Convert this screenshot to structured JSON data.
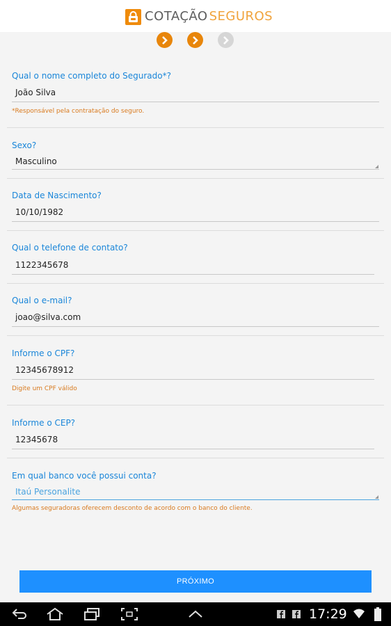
{
  "header": {
    "title_part1": "COTAÇÃO",
    "title_part2": "SEGUROS"
  },
  "steps": [
    {
      "state": "done",
      "icon": "chevron-right-icon"
    },
    {
      "state": "done",
      "icon": "chevron-right-icon"
    },
    {
      "state": "pending",
      "icon": "chevron-right-icon"
    }
  ],
  "form": {
    "name": {
      "label": "Qual o nome completo do Segurado*?",
      "value": "João Silva",
      "hint": "*Responsável pela contratação do seguro."
    },
    "sex": {
      "label": "Sexo?",
      "value": "Masculino"
    },
    "birth": {
      "label": "Data de Nascimento?",
      "value": "10/10/1982"
    },
    "phone": {
      "label": "Qual o telefone de contato?",
      "value": "1122345678"
    },
    "email": {
      "label": "Qual o e-mail?",
      "value": "joao@silva.com"
    },
    "cpf": {
      "label": "Informe o CPF?",
      "value": "12345678912",
      "hint": "Digite um CPF válido"
    },
    "cep": {
      "label": "Informe o CEP?",
      "value": "12345678"
    },
    "bank": {
      "label": "Em qual banco você possui conta?",
      "value": "Itaú Personalite",
      "hint": "Algumas seguradoras oferecem desconto de acordo com o banco do cliente."
    }
  },
  "next_button": {
    "label": "PRÓXIMO"
  },
  "status_bar": {
    "time": "17:29"
  },
  "colors": {
    "accent": "#1e90ff",
    "label": "#1a86d9",
    "orange": "#e8860b",
    "hint": "#d97a1e"
  }
}
